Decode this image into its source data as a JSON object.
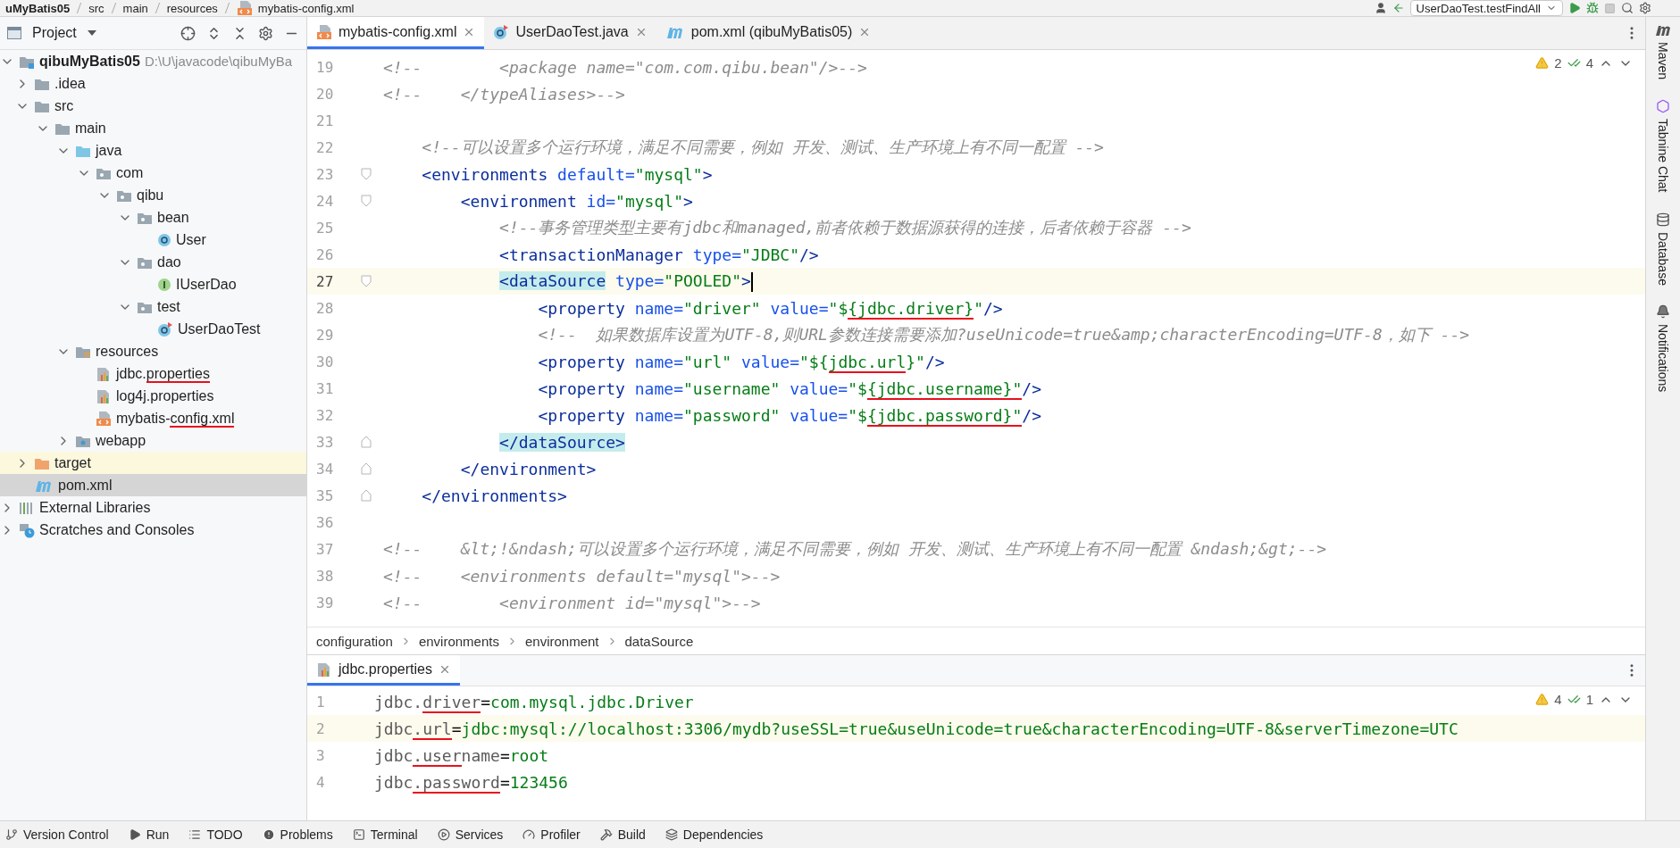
{
  "top_bar": {
    "breadcrumbs": [
      "uMyBatis05",
      "src",
      "main",
      "resources",
      "mybatis-config.xml"
    ],
    "run_config": "UserDaoTest.testFindAll"
  },
  "project_pane": {
    "title": "Project",
    "tree": [
      {
        "label": [
          {
            "text": "qibuMyBatis05"
          }
        ],
        "path": "D:\\U\\javacode\\qibuMyBa",
        "kind": "module",
        "expanded": true,
        "selected": false,
        "children": [
          {
            "label": [
              {
                "text": ".idea"
              }
            ],
            "kind": "folder",
            "expanded": false,
            "selected": false
          },
          {
            "label": [
              {
                "text": "src"
              }
            ],
            "kind": "folder",
            "expanded": true,
            "selected": false,
            "children": [
              {
                "label": [
                  {
                    "text": "main"
                  }
                ],
                "kind": "folder",
                "expanded": true,
                "selected": false,
                "children": [
                  {
                    "label": [
                      {
                        "text": "java"
                      }
                    ],
                    "kind": "source-folder",
                    "expanded": true,
                    "selected": false,
                    "children": [
                      {
                        "label": [
                          {
                            "text": "com"
                          }
                        ],
                        "kind": "package",
                        "expanded": true,
                        "selected": false,
                        "children": [
                          {
                            "label": [
                              {
                                "text": "qibu"
                              }
                            ],
                            "kind": "package",
                            "expanded": true,
                            "selected": false,
                            "children": [
                              {
                                "label": [
                                  {
                                    "text": "bean"
                                  }
                                ],
                                "kind": "package",
                                "expanded": true,
                                "selected": false,
                                "children": [
                                  {
                                    "label": [
                                      {
                                        "text": "User"
                                      }
                                    ],
                                    "kind": "class",
                                    "selected": false
                                  }
                                ]
                              },
                              {
                                "label": [
                                  {
                                    "text": "dao"
                                  }
                                ],
                                "kind": "package",
                                "expanded": true,
                                "selected": false,
                                "children": [
                                  {
                                    "label": [
                                      {
                                        "text": "IUserDao"
                                      }
                                    ],
                                    "kind": "interface",
                                    "selected": false
                                  }
                                ]
                              },
                              {
                                "label": [
                                  {
                                    "text": "test"
                                  }
                                ],
                                "kind": "package",
                                "expanded": true,
                                "selected": false,
                                "children": [
                                  {
                                    "label": [
                                      {
                                        "text": "UserDaoTest"
                                      }
                                    ],
                                    "kind": "test-class",
                                    "selected": false
                                  }
                                ]
                              }
                            ]
                          }
                        ]
                      }
                    ]
                  },
                  {
                    "label": [
                      {
                        "text": "resources"
                      }
                    ],
                    "kind": "resources-folder",
                    "expanded": true,
                    "selected": false,
                    "children": [
                      {
                        "label": [
                          {
                            "text": "jdbc."
                          },
                          {
                            "text": "properties",
                            "underlined": true
                          }
                        ],
                        "kind": "properties",
                        "selected": false
                      },
                      {
                        "label": [
                          {
                            "text": "log4j.properties"
                          }
                        ],
                        "kind": "properties",
                        "selected": false
                      },
                      {
                        "label": [
                          {
                            "text": "mybatis-"
                          },
                          {
                            "text": "config.xml",
                            "underlined": true
                          }
                        ],
                        "kind": "xml",
                        "selected": false
                      }
                    ]
                  },
                  {
                    "label": [
                      {
                        "text": "webapp"
                      }
                    ],
                    "kind": "web-folder",
                    "expanded": false,
                    "selected": false
                  }
                ]
              }
            ]
          },
          {
            "label": [
              {
                "text": "target"
              }
            ],
            "kind": "excluded-folder",
            "expanded": false,
            "selected": false
          },
          {
            "label": [
              {
                "text": "pom.xml"
              }
            ],
            "kind": "maven",
            "selected": true
          }
        ]
      },
      {
        "label": [
          {
            "text": "External Libraries"
          }
        ],
        "kind": "libraries",
        "expanded": false,
        "selected": false
      },
      {
        "label": [
          {
            "text": "Scratches and Consoles"
          }
        ],
        "kind": "scratches",
        "expanded": false,
        "selected": false
      }
    ]
  },
  "editor_tabs": [
    {
      "label": "mybatis-config.xml",
      "kind": "xml",
      "selected": true
    },
    {
      "label": "UserDaoTest.java",
      "kind": "test-class",
      "selected": false
    },
    {
      "label": "pom.xml (qibuMyBatis05)",
      "kind": "maven",
      "selected": false
    }
  ],
  "editor": {
    "inspections": {
      "warnings": "2",
      "checks": "4"
    },
    "lines": [
      {
        "n": "19",
        "kind": "plain",
        "segments": [
          {
            "kind": "comment",
            "t": "<!--        <package name=\"com.com.qibu.bean\"/>-->"
          }
        ]
      },
      {
        "n": "20",
        "kind": "plain",
        "segments": [
          {
            "kind": "comment",
            "t": "<!--    </typeAliases>-->"
          }
        ]
      },
      {
        "n": "21",
        "kind": "plain"
      },
      {
        "n": "22",
        "kind": "plain",
        "segments": [
          {
            "kind": "comment",
            "t": "    <!--可以设置多个运行环境，满足不同需要，例如 开发、测试、生产环境上有不同一配置 -->"
          }
        ]
      },
      {
        "n": "23",
        "kind": "fold-start",
        "segments": [
          {
            "kind": "tag",
            "t": "    <environments"
          },
          {
            "kind": "attribute",
            "t": " default="
          },
          {
            "kind": "value",
            "t": "\"mysql\""
          },
          {
            "kind": "tag",
            "t": ">"
          }
        ]
      },
      {
        "n": "24",
        "kind": "fold-start",
        "segments": [
          {
            "kind": "tag",
            "t": "        <environment"
          },
          {
            "kind": "attribute",
            "t": " id="
          },
          {
            "kind": "value",
            "t": "\"mysql\""
          },
          {
            "kind": "tag",
            "t": ">"
          }
        ]
      },
      {
        "n": "25",
        "kind": "plain",
        "segments": [
          {
            "kind": "comment",
            "t": "            <!--事务管理类型主要有jdbc和managed,前者依赖于数据源获得的连接，后者依赖于容器 -->"
          }
        ]
      },
      {
        "n": "26",
        "kind": "plain",
        "segments": [
          {
            "kind": "tag",
            "t": "            <transactionManager"
          },
          {
            "kind": "attribute",
            "t": " type="
          },
          {
            "kind": "value",
            "t": "\"JDBC\""
          },
          {
            "kind": "tag",
            "t": "/>"
          }
        ]
      },
      {
        "n": "27",
        "kind": "fold-start",
        "current": true,
        "segments": [
          {
            "kind": "tag",
            "t": "            <dataSource",
            "matched": true
          },
          {
            "kind": "attribute",
            "t": " type="
          },
          {
            "kind": "value",
            "t": "\"POOLED\""
          },
          {
            "kind": "tag",
            "t": ">"
          }
        ]
      },
      {
        "n": "28",
        "kind": "plain",
        "segments": [
          {
            "kind": "tag",
            "t": "                <property"
          },
          {
            "kind": "attribute",
            "t": " name="
          },
          {
            "kind": "value",
            "t": "\"driver\""
          },
          {
            "kind": "attribute",
            "t": " value="
          },
          {
            "kind": "value",
            "t": "\"$"
          },
          {
            "kind": "value",
            "t": "{jdbc.driver}",
            "underlined": true
          },
          {
            "kind": "value",
            "t": "\""
          },
          {
            "kind": "tag",
            "t": "/>"
          }
        ]
      },
      {
        "n": "29",
        "kind": "plain",
        "segments": [
          {
            "kind": "comment",
            "t": "                <!--  如果数据库设置为UTF-8,则URL参数连接需要添加?useUnicode=true&amp;characterEncoding=UTF-8，如下 -->"
          }
        ]
      },
      {
        "n": "30",
        "kind": "plain",
        "segments": [
          {
            "kind": "tag",
            "t": "                <property"
          },
          {
            "kind": "attribute",
            "t": " name="
          },
          {
            "kind": "value",
            "t": "\"url\""
          },
          {
            "kind": "attribute",
            "t": " value="
          },
          {
            "kind": "value",
            "t": "\"${"
          },
          {
            "kind": "value",
            "t": "jdbc.url",
            "underlined": true
          },
          {
            "kind": "value",
            "t": "}\""
          },
          {
            "kind": "tag",
            "t": "/>"
          }
        ]
      },
      {
        "n": "31",
        "kind": "plain",
        "segments": [
          {
            "kind": "tag",
            "t": "                <property"
          },
          {
            "kind": "attribute",
            "t": " name="
          },
          {
            "kind": "value",
            "t": "\"username\""
          },
          {
            "kind": "attribute",
            "t": " value="
          },
          {
            "kind": "value",
            "t": "\"$"
          },
          {
            "kind": "value",
            "t": "{jdbc.username}\"",
            "underlined": true
          },
          {
            "kind": "tag",
            "t": "/>"
          }
        ]
      },
      {
        "n": "32",
        "kind": "plain",
        "segments": [
          {
            "kind": "tag",
            "t": "                <property"
          },
          {
            "kind": "attribute",
            "t": " name="
          },
          {
            "kind": "value",
            "t": "\"password\""
          },
          {
            "kind": "attribute",
            "t": " value="
          },
          {
            "kind": "value",
            "t": "\"$"
          },
          {
            "kind": "value",
            "t": "{jdbc.password}\"",
            "underlined": true
          },
          {
            "kind": "tag",
            "t": "/>"
          }
        ]
      },
      {
        "n": "33",
        "kind": "fold-end",
        "segments": [
          {
            "kind": "tag",
            "t": "            </dataSource>",
            "matched": true
          }
        ]
      },
      {
        "n": "34",
        "kind": "fold-end",
        "segments": [
          {
            "kind": "tag",
            "t": "        </environment>"
          }
        ]
      },
      {
        "n": "35",
        "kind": "fold-end",
        "segments": [
          {
            "kind": "tag",
            "t": "    </environments>"
          }
        ]
      },
      {
        "n": "36",
        "kind": "plain"
      },
      {
        "n": "37",
        "kind": "plain",
        "segments": [
          {
            "kind": "comment",
            "t": "<!--    &lt;!&ndash;可以设置多个运行环境，满足不同需要，例如 开发、测试、生产环境上有不同一配置 &ndash;&gt;-->"
          }
        ]
      },
      {
        "n": "38",
        "kind": "plain",
        "segments": [
          {
            "kind": "comment",
            "t": "<!--    <environments default=\"mysql\">-->"
          }
        ]
      },
      {
        "n": "39",
        "kind": "plain",
        "segments": [
          {
            "kind": "comment",
            "t": "<!--        <environment id=\"mysql\">-->"
          }
        ]
      }
    ]
  },
  "breadcrumbs": [
    "configuration",
    "environments",
    "environment",
    "dataSource"
  ],
  "bottom_editor": {
    "tab": {
      "label": "jdbc.properties",
      "kind": "properties",
      "selected": true
    },
    "inspections": {
      "warnings": "4",
      "checks": "1"
    },
    "lines": [
      {
        "n": "1",
        "segments": [
          {
            "kind": "key",
            "t": "jdbc."
          },
          {
            "kind": "key",
            "t": "driver",
            "underlined": true
          },
          {
            "kind": "plain",
            "t": "="
          },
          {
            "kind": "string",
            "t": "com.mysql.jdbc.Driver"
          }
        ]
      },
      {
        "n": "2",
        "current": true,
        "segments": [
          {
            "kind": "key",
            "t": "jdbc"
          },
          {
            "kind": "key",
            "t": ".url",
            "underlined": true
          },
          {
            "kind": "plain",
            "t": "="
          },
          {
            "kind": "string",
            "t": "jdbc:mysql://localhost:3306/mydb?useSSL=true&useUnicode=true&characterEncoding=UTF-8&serverTimezone=UTC"
          }
        ]
      },
      {
        "n": "3",
        "segments": [
          {
            "kind": "key",
            "t": "jdbc"
          },
          {
            "kind": "key",
            "t": ".user",
            "underlined": true
          },
          {
            "kind": "key",
            "t": "name"
          },
          {
            "kind": "plain",
            "t": "="
          },
          {
            "kind": "string",
            "t": "root"
          }
        ]
      },
      {
        "n": "4",
        "segments": [
          {
            "kind": "key",
            "t": "jdbc"
          },
          {
            "kind": "key",
            "t": ".password",
            "underlined": true
          },
          {
            "kind": "plain",
            "t": "="
          },
          {
            "kind": "string",
            "t": "123456"
          }
        ]
      }
    ]
  },
  "right_strip": [
    {
      "label": "Maven",
      "kind": "maven"
    },
    {
      "label": "Tabnine Chat",
      "kind": "tabnine"
    },
    {
      "label": "Database",
      "kind": "database"
    },
    {
      "label": "Notifications",
      "kind": "notifications"
    }
  ],
  "tool_bar": [
    {
      "label": "Version Control",
      "kind": "vcs"
    },
    {
      "label": "Run",
      "kind": "run"
    },
    {
      "label": "TODO",
      "kind": "todo"
    },
    {
      "label": "Problems",
      "kind": "problems"
    },
    {
      "label": "Terminal",
      "kind": "terminal"
    },
    {
      "label": "Services",
      "kind": "services"
    },
    {
      "label": "Profiler",
      "kind": "profiler"
    },
    {
      "label": "Build",
      "kind": "build"
    },
    {
      "label": "Dependencies",
      "kind": "dependencies"
    }
  ]
}
